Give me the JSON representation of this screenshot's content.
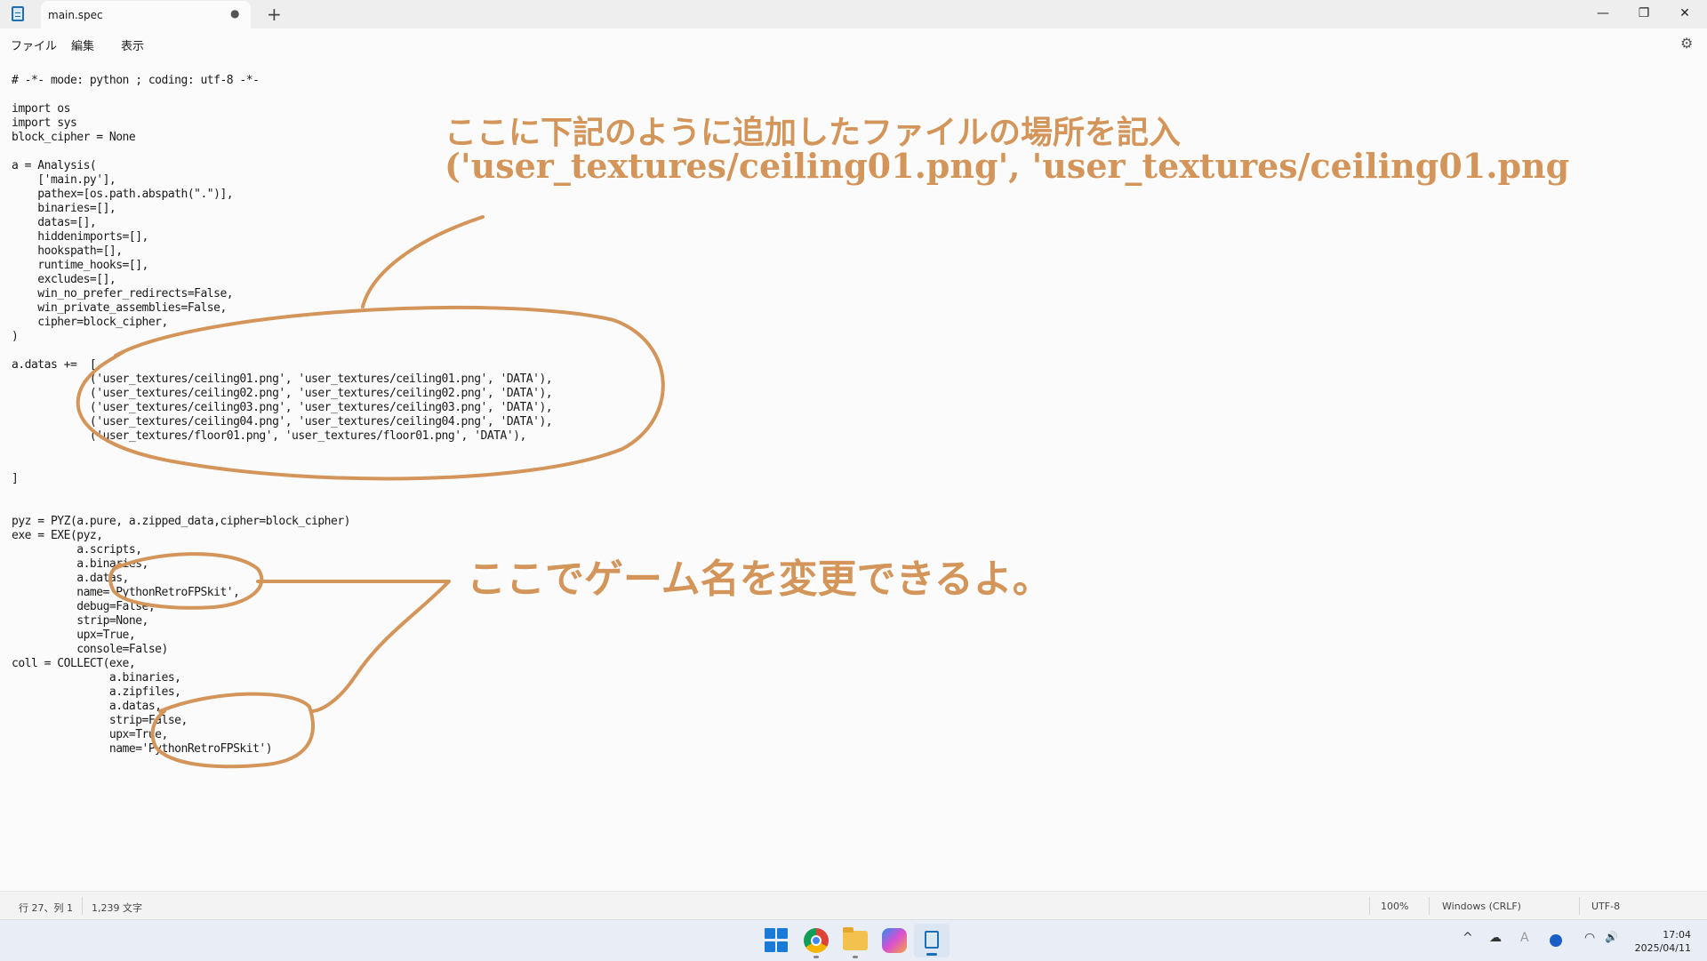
{
  "window": {
    "tab_title": "main.spec",
    "tab_modified": "●",
    "new_tab": "+",
    "minimize": "—",
    "maximize": "❐",
    "close": "✕"
  },
  "menu": {
    "file": "ファイル",
    "edit": "編集",
    "view": "表示"
  },
  "code_lines": [
    "# -*- mode: python ; coding: utf-8 -*-",
    "",
    "import os",
    "import sys",
    "block_cipher = None",
    "",
    "a = Analysis(",
    "    ['main.py'],",
    "    pathex=[os.path.abspath(\".\")],",
    "    binaries=[],",
    "    datas=[],",
    "    hiddenimports=[],",
    "    hookspath=[],",
    "    runtime_hooks=[],",
    "    excludes=[],",
    "    win_no_prefer_redirects=False,",
    "    win_private_assemblies=False,",
    "    cipher=block_cipher,",
    ")",
    "",
    "a.datas +=  [",
    "            ('user_textures/ceiling01.png', 'user_textures/ceiling01.png', 'DATA'),",
    "            ('user_textures/ceiling02.png', 'user_textures/ceiling02.png', 'DATA'),",
    "            ('user_textures/ceiling03.png', 'user_textures/ceiling03.png', 'DATA'),",
    "            ('user_textures/ceiling04.png', 'user_textures/ceiling04.png', 'DATA'),",
    "            ('user_textures/floor01.png', 'user_textures/floor01.png', 'DATA'),",
    "",
    "",
    "]",
    "",
    "",
    "pyz = PYZ(a.pure, a.zipped_data,cipher=block_cipher)",
    "exe = EXE(pyz,",
    "          a.scripts,",
    "          a.binaries,",
    "          a.datas,",
    "          name='PythonRetroFPSkit',",
    "          debug=False,",
    "          strip=None,",
    "          upx=True,",
    "          console=False)",
    "coll = COLLECT(exe,",
    "               a.binaries,",
    "               a.zipfiles,",
    "               a.datas,",
    "               strip=False,",
    "               upx=True,",
    "               name='PythonRetroFPSkit')"
  ],
  "annotations": {
    "note1_line1": "ここに下記のように追加したファイルの場所を記入",
    "note1_line2": "('user_textures/ceiling01.png', 'user_textures/ceiling01.png",
    "note2": "ここでゲーム名を変更できるよ。",
    "color": "#d4955a"
  },
  "status": {
    "position": "行 27、列 1",
    "char_count": "1,239 文字",
    "zoom": "100%",
    "line_ending": "Windows (CRLF)",
    "encoding": "UTF-8"
  },
  "taskbar": {
    "time": "17:04",
    "date": "2025/04/11",
    "tray_chevron": "^",
    "tray_cloud": "☁",
    "tray_ime": "A",
    "tray_wifi": "◠",
    "tray_volume": "🔊"
  },
  "icons": {
    "settings": "⚙"
  }
}
